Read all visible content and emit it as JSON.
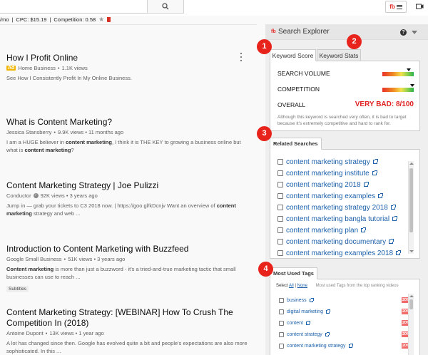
{
  "topbar": {
    "search_icon": "search-icon",
    "badge_text": "fb",
    "metrics_prefix": "/mo",
    "cpc": "CPC: $15.19",
    "competition": "Competition: 0.58"
  },
  "results": [
    {
      "title": "How I Profit Online",
      "ad_label": "Ad",
      "channel": "Home Business",
      "stats": "1.1K views",
      "desc": "See How I Consistently Profit In My Online Business."
    },
    {
      "title": "What is Content Marketing?",
      "channel": "Jessica Stansberry",
      "stats": "9.9K views • 11 months ago",
      "desc_parts": [
        "I am a HUGE believer in ",
        "content marketing",
        ", I think it is THE KEY to growing a business online but what is ",
        "content marketing",
        "?"
      ]
    },
    {
      "title": "Content Marketing Strategy | Joe Pulizzi",
      "channel": "Conductor",
      "stats": "92K views • 3 years ago",
      "desc_parts": [
        "Jump in — grab your tickets to C3 2018 now. | https://goo.gl/kDcnjv Want an overview of ",
        "content marketing",
        " strategy and web ..."
      ]
    },
    {
      "title": "Introduction to Content Marketing with Buzzfeed",
      "channel": "Google Small Business",
      "stats": "51K views • 3 years ago",
      "desc_parts": [
        "",
        "Content marketing",
        " is more than just a buzzword - it's a tried-and-true marketing tactic that small businesses can use to reach ..."
      ],
      "chip": "Subtitles"
    },
    {
      "title": "Content Marketing Strategy: [WEBINAR] How To Crush The Competition In (2018)",
      "channel": "Antoine Dupont",
      "stats": "13K views • 1 year ago",
      "desc": "A lot has changed since then. Google has evolved quite a bit and people's expectations are also more sophisticated. In this ..."
    }
  ],
  "panel": {
    "logo": "fb",
    "title": "Search Explorer",
    "help": "?",
    "tabs": [
      "Keyword Score",
      "Keyword Stats"
    ],
    "score": {
      "search_volume_label": "SEARCH VOLUME",
      "competition_label": "COMPETITION",
      "overall_label": "OVERALL",
      "overall_value": "VERY BAD: 8/100",
      "search_volume_level": 0.85,
      "competition_level": 0.95,
      "note": "Although this keyword is searched very often, it is bad to target because it's extremely competitive and hard to rank for."
    },
    "related": {
      "tab_label": "Related Searches",
      "items": [
        "content marketing strategy",
        "content marketing institute",
        "content marketing 2018",
        "content marketing examples",
        "content marketing strategy 2018",
        "content marketing bangla tutorial",
        "content marketing plan",
        "content marketing documentary",
        "content marketing examples 2018"
      ]
    },
    "tags": {
      "tab_label": "Most Used Tags",
      "select_label": "Select",
      "all_label": "All",
      "sep": "|",
      "none_label": "None",
      "hint": "Most used Tags from the top ranking videos",
      "items": [
        {
          "name": "business",
          "pct": "20%"
        },
        {
          "name": "digital marketing",
          "pct": "20%"
        },
        {
          "name": "content",
          "pct": "20%"
        },
        {
          "name": "content strategy",
          "pct": "20%"
        },
        {
          "name": "content marketing strategy",
          "pct": "20%"
        }
      ]
    },
    "steps": [
      "1",
      "2",
      "3",
      "4"
    ]
  },
  "colors": {
    "accent_red": "#e8231c",
    "link_blue": "#1a5faa",
    "bad_red": "#e01f1f"
  }
}
